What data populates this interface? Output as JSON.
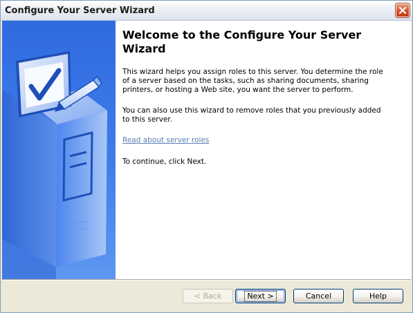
{
  "window": {
    "title": "Configure Your Server Wizard"
  },
  "wizard": {
    "heading": "Welcome to the Configure Your Server Wizard",
    "paragraph1": "This wizard helps you assign roles to this server. You determine the role of a server based on the tasks, such as sharing documents, sharing printers, or hosting a Web site, you want the server to perform.",
    "paragraph2": "You can also use this wizard to remove roles that you previously added to this server.",
    "link": "Read about server roles",
    "paragraph3": "To continue, click Next."
  },
  "buttons": {
    "back": "< Back",
    "next": "Next >",
    "cancel": "Cancel",
    "help": "Help"
  },
  "icons": {
    "close": "close-icon",
    "illustration": "server-checkmark-illustration"
  },
  "colors": {
    "side_panel": "#3F7DEB",
    "link": "#5A7FB4",
    "close_button": "#D4512A"
  }
}
